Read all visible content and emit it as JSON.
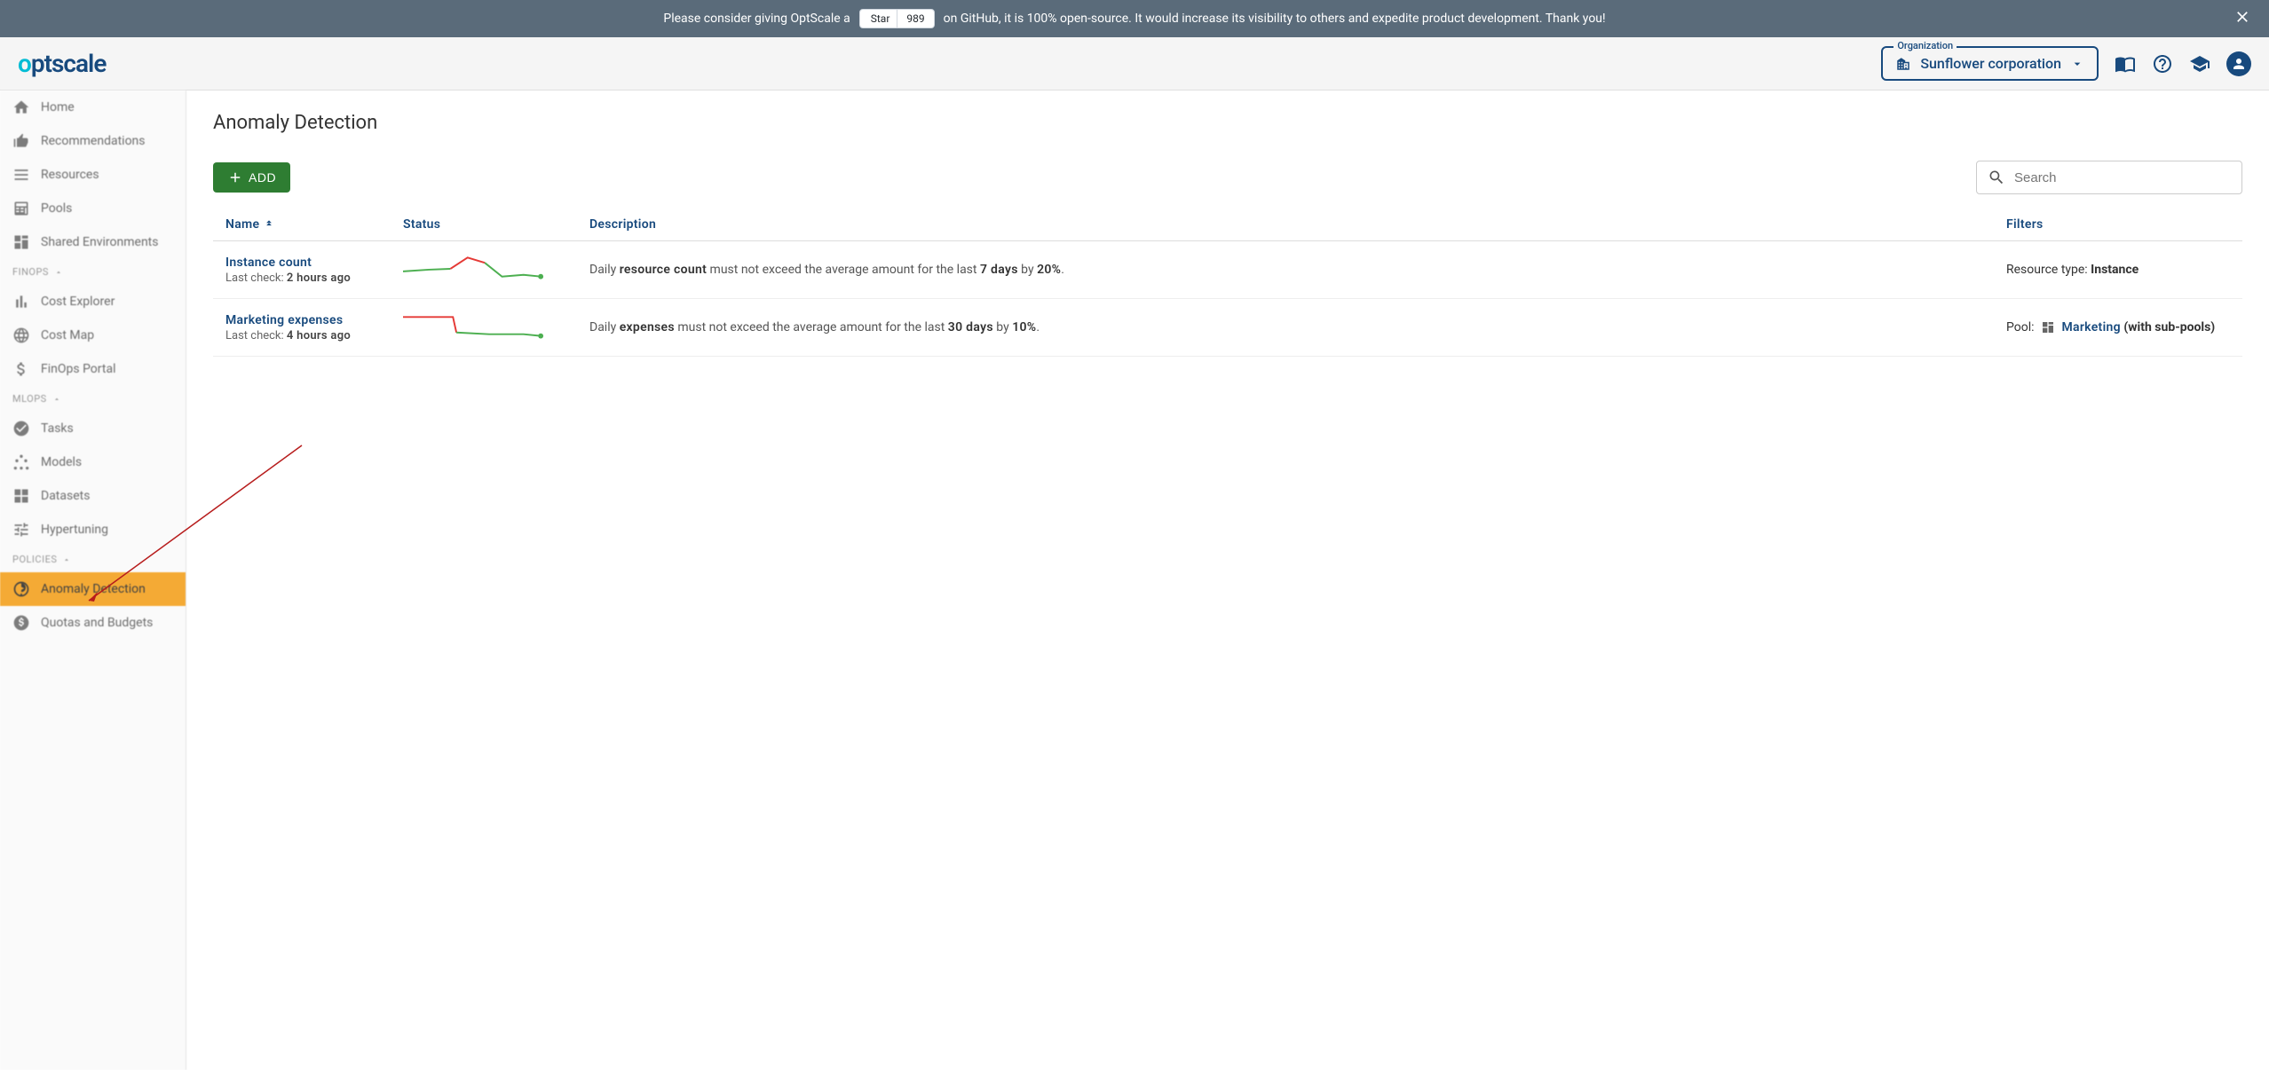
{
  "banner": {
    "pre": "Please consider giving OptScale a",
    "star_label": "Star",
    "star_count": "989",
    "post": "on GitHub, it is 100% open-source. It would increase its visibility to others and expedite product development. Thank you!"
  },
  "header": {
    "logo": "optscale",
    "org_label": "Organization",
    "org_value": "Sunflower corporation"
  },
  "sidebar": {
    "items": [
      {
        "label": "Home"
      },
      {
        "label": "Recommendations"
      },
      {
        "label": "Resources"
      },
      {
        "label": "Pools"
      },
      {
        "label": "Shared Environments"
      }
    ],
    "section_finops": "FINOPS",
    "finops": [
      {
        "label": "Cost Explorer"
      },
      {
        "label": "Cost Map"
      },
      {
        "label": "FinOps Portal"
      }
    ],
    "section_mlops": "MLOPS",
    "mlops": [
      {
        "label": "Tasks"
      },
      {
        "label": "Models"
      },
      {
        "label": "Datasets"
      },
      {
        "label": "Hypertuning"
      }
    ],
    "section_policies": "POLICIES",
    "policies": [
      {
        "label": "Anomaly Detection"
      },
      {
        "label": "Quotas and Budgets"
      }
    ]
  },
  "page": {
    "title": "Anomaly Detection",
    "add_button": "ADD",
    "search_placeholder": "Search",
    "columns": {
      "name": "Name",
      "status": "Status",
      "description": "Description",
      "filters": "Filters"
    },
    "rows": [
      {
        "name": "Instance count",
        "last_check_label": "Last check:",
        "last_check_value": "2 hours ago",
        "desc_pre": "Daily ",
        "desc_metric": "resource count",
        "desc_mid": " must not exceed the average amount for the last ",
        "desc_days": "7 days",
        "desc_by": " by ",
        "desc_pct": "20%",
        "desc_end": ".",
        "filter_label": "Resource type: ",
        "filter_value": "Instance"
      },
      {
        "name": "Marketing expenses",
        "last_check_label": "Last check:",
        "last_check_value": "4 hours ago",
        "desc_pre": "Daily ",
        "desc_metric": "expenses",
        "desc_mid": " must not exceed the average amount for the last ",
        "desc_days": "30 days",
        "desc_by": " by ",
        "desc_pct": "10%",
        "desc_end": ".",
        "filter_label": "Pool: ",
        "filter_link": "Marketing",
        "filter_suffix": " (with sub-pools)"
      }
    ]
  },
  "chart_data": [
    {
      "type": "line",
      "title": "Instance count sparkline",
      "segments": [
        {
          "color": "#4caf50",
          "points": [
            [
              0,
              22
            ],
            [
              30,
              20
            ],
            [
              55,
              19
            ]
          ]
        },
        {
          "color": "#e53935",
          "points": [
            [
              55,
              19
            ],
            [
              75,
              6
            ],
            [
              95,
              12
            ]
          ]
        },
        {
          "color": "#4caf50",
          "points": [
            [
              95,
              12
            ],
            [
              115,
              28
            ],
            [
              140,
              26
            ],
            [
              160,
              28
            ]
          ]
        }
      ],
      "endpoint": [
        160,
        28
      ]
    },
    {
      "type": "line",
      "title": "Marketing expenses sparkline",
      "segments": [
        {
          "color": "#e53935",
          "points": [
            [
              0,
              8
            ],
            [
              58,
              8
            ],
            [
              62,
              26
            ]
          ]
        },
        {
          "color": "#4caf50",
          "points": [
            [
              62,
              26
            ],
            [
              100,
              28
            ],
            [
              140,
              28
            ],
            [
              160,
              30
            ]
          ]
        }
      ],
      "endpoint": [
        160,
        30
      ]
    }
  ]
}
